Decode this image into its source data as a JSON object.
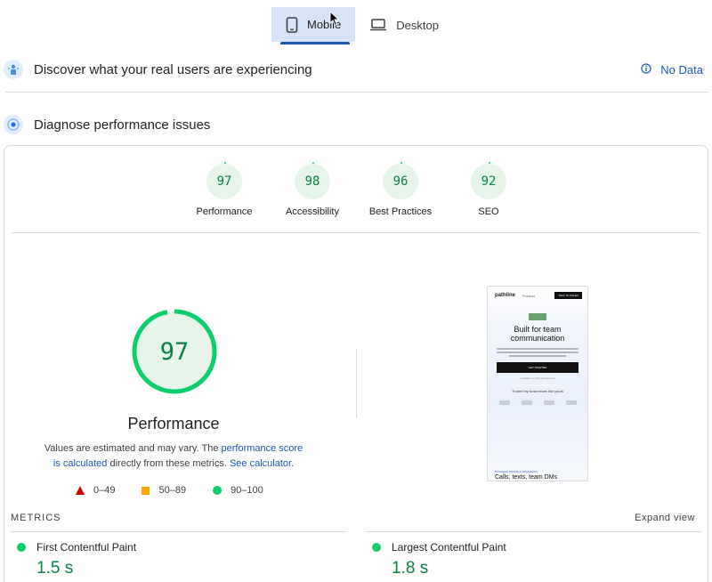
{
  "tabs": [
    {
      "label": "Mobile",
      "icon": "phone-icon",
      "active": true
    },
    {
      "label": "Desktop",
      "icon": "laptop-icon",
      "active": false
    }
  ],
  "crux": {
    "title": "Discover what your real users are experiencing",
    "no_data_label": "No Data"
  },
  "diagnose": {
    "title": "Diagnose performance issues"
  },
  "categories": [
    {
      "score": "97",
      "label": "Performance"
    },
    {
      "score": "98",
      "label": "Accessibility"
    },
    {
      "score": "96",
      "label": "Best Practices"
    },
    {
      "score": "92",
      "label": "SEO"
    }
  ],
  "performance": {
    "score": "97",
    "score_value": 97,
    "label": "Performance",
    "desc_prefix": "Values are estimated and may vary. The ",
    "desc_link1": "performance score is calculated",
    "desc_middle": " directly from these metrics. ",
    "desc_link2": "See calculator."
  },
  "legend": [
    {
      "shape": "triangle",
      "range": "0–49",
      "color": "#cc0000"
    },
    {
      "shape": "square",
      "range": "50–89",
      "color": "#ffa400"
    },
    {
      "shape": "circle",
      "range": "90–100",
      "color": "#0cce6b"
    }
  ],
  "screenshot": {
    "logo": "pathline",
    "product": "Product",
    "cta": "TALK TO SALES",
    "headline": "Built for team communication",
    "button": "GET STARTED",
    "available": "Available on iOS and the web",
    "trusted": "Trusted by businesses like yours",
    "section_label": "BUSINESS PHONE & MESSAGING",
    "section_headline": "Calls, texts, team DMs"
  },
  "metrics": {
    "title": "METRICS",
    "expand_label": "Expand view",
    "items": [
      {
        "name": "First Contentful Paint",
        "value": "1.5 s"
      },
      {
        "name": "Largest Contentful Paint",
        "value": "1.8 s"
      }
    ]
  },
  "colors": {
    "accent": "#1a56b8",
    "good": "#0cce6b",
    "good_text": "#0b8043",
    "tab_active_bg": "#d7e3f8"
  }
}
